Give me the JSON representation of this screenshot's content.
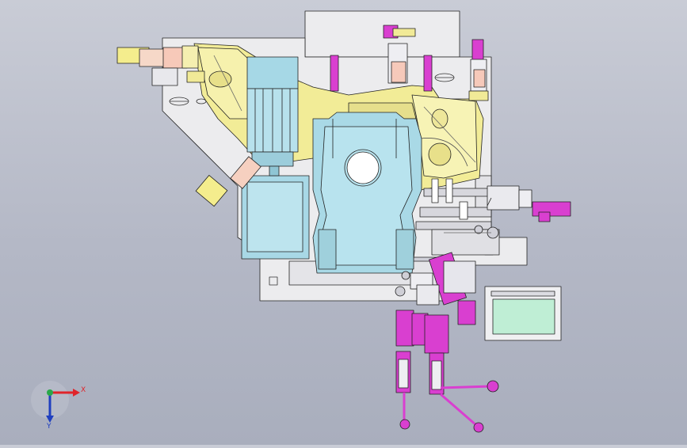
{
  "triad": {
    "x_label": "X",
    "y_label": "Y",
    "colors": {
      "x": "#e0242a",
      "y": "#1f3fbf",
      "origin": "#2aa84a"
    }
  },
  "colors": {
    "background_top": "#c9ccd6",
    "background_bottom": "#a9aebd",
    "base_plate": "#ebebed",
    "fixture_yellow": "#f3ee9a",
    "motor_blue": "#a8dbe8",
    "clamp_magenta": "#d83fd0",
    "screen_green": "#bff0d2"
  },
  "icons": [
    "axis-triad-icon"
  ]
}
